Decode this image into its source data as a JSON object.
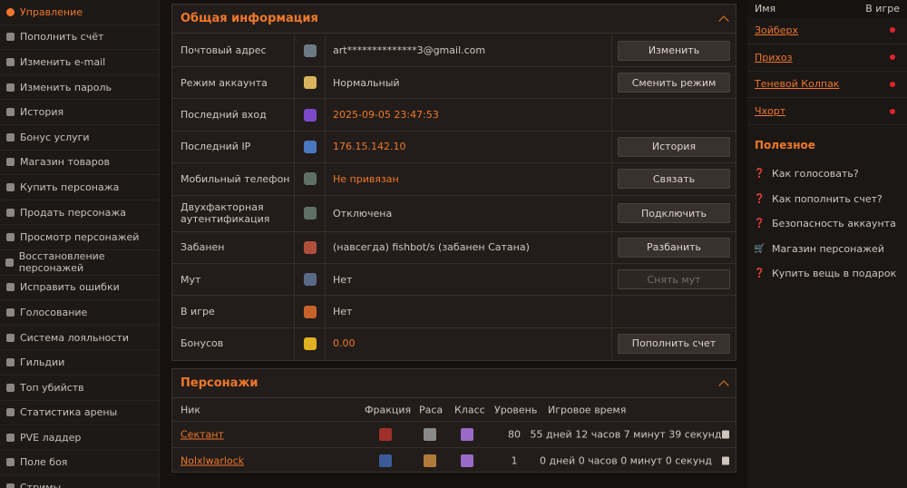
{
  "sidebar": {
    "items": [
      {
        "label": "Управление",
        "icon": "gear-icon",
        "active": true
      },
      {
        "label": "Пополнить счёт",
        "icon": "plus-circle-icon"
      },
      {
        "label": "Изменить e-mail",
        "icon": "envelope-icon"
      },
      {
        "label": "Изменить пароль",
        "icon": "lock-icon"
      },
      {
        "label": "История",
        "icon": "history-icon"
      },
      {
        "label": "Бонус услуги",
        "icon": "gift-icon"
      },
      {
        "label": "Магазин товаров",
        "icon": "cart-icon"
      },
      {
        "label": "Купить персонажа",
        "icon": "tag-icon"
      },
      {
        "label": "Продать персонажа",
        "icon": "tag-icon"
      },
      {
        "label": "Просмотр персонажей",
        "icon": "user-icon"
      },
      {
        "label": "Восстановление персонажей",
        "icon": "restore-icon"
      },
      {
        "label": "Исправить ошибки",
        "icon": "shield-icon"
      },
      {
        "label": "Голосование",
        "icon": "flag-icon"
      },
      {
        "label": "Система лояльности",
        "icon": "card-icon"
      },
      {
        "label": "Гильдии",
        "icon": "users-icon"
      },
      {
        "label": "Топ убийств",
        "icon": "chart-icon"
      },
      {
        "label": "Статистика арены",
        "icon": "chart-icon"
      },
      {
        "label": "PVE ладдер",
        "icon": "chart-icon"
      },
      {
        "label": "Поле боя",
        "icon": "chart-icon"
      },
      {
        "label": "Стримы",
        "icon": "video-icon"
      }
    ]
  },
  "info": {
    "title": "Общая информация",
    "rows": [
      {
        "label": "Почтовый адрес",
        "icon_color": "#6c7a86",
        "value": "art**************3@gmail.com",
        "value_orange": false,
        "button": "Изменить"
      },
      {
        "label": "Режим аккаунта",
        "icon_color": "#d9b45a",
        "value": "Нормальный",
        "value_orange": false,
        "button": "Сменить режим"
      },
      {
        "label": "Последний вход",
        "icon_color": "#7a4ac8",
        "value": "2025-09-05 23:47:53",
        "value_orange": true,
        "button": ""
      },
      {
        "label": "Последний IP",
        "icon_color": "#4a78c0",
        "value": "176.15.142.10",
        "value_orange": true,
        "button": "История"
      },
      {
        "label": "Мобильный телефон",
        "icon_color": "#5e7066",
        "value": "Не привязан",
        "value_orange": true,
        "button": "Связать"
      },
      {
        "label": "Двухфакторная аутентификация",
        "icon_color": "#5e7066",
        "value": "Отключена",
        "value_orange": false,
        "button": "Подключить"
      },
      {
        "label": "Забанен",
        "icon_color": "#b0503a",
        "value": "(навсегда) fishbot/s (забанен Сатана)",
        "value_orange": false,
        "button": "Разбанить"
      },
      {
        "label": "Мут",
        "icon_color": "#5a6a86",
        "value": "Нет",
        "value_orange": false,
        "button": "Снять мут",
        "disabled": true
      },
      {
        "label": "В игре",
        "icon_color": "#c8622a",
        "value": "Нет",
        "value_orange": false,
        "button": ""
      },
      {
        "label": "Бонусов",
        "icon_color": "#e0b020",
        "value": "0.00",
        "value_orange": true,
        "button": "Пополнить счет"
      }
    ]
  },
  "chars": {
    "title": "Персонажи",
    "headers": {
      "nick": "Ник",
      "faction": "Фракция",
      "race": "Раса",
      "class": "Класс",
      "level": "Уровень",
      "playtime": "Игровое время"
    },
    "rows": [
      {
        "nick": "Сектант",
        "faction_color": "#a0302a",
        "race_color": "#8a8a8a",
        "class_color": "#9a6ac8",
        "level": "80",
        "playtime": "55 дней 12 часов 7 минут 39 секунд"
      },
      {
        "nick": "Nolxlwarlock",
        "faction_color": "#3a5a9a",
        "race_color": "#b07a3a",
        "class_color": "#9a6ac8",
        "level": "1",
        "playtime": "0 дней 0 часов 0 минут 0 секунд"
      }
    ]
  },
  "right": {
    "header_name": "Имя",
    "header_ingame": "В игре",
    "friends": [
      "Зойберх",
      "Прихоз",
      "Теневой Колпак",
      "Чхорт"
    ],
    "useful_title": "Полезное",
    "useful": [
      {
        "label": "Как голосовать?",
        "icon": "question-icon"
      },
      {
        "label": "Как пополнить счет?",
        "icon": "question-icon"
      },
      {
        "label": "Безопасность аккаунта",
        "icon": "question-icon"
      },
      {
        "label": "Магазин персонажей",
        "icon": "cart-icon"
      },
      {
        "label": "Купить вещь в подарок",
        "icon": "question-icon"
      }
    ]
  }
}
